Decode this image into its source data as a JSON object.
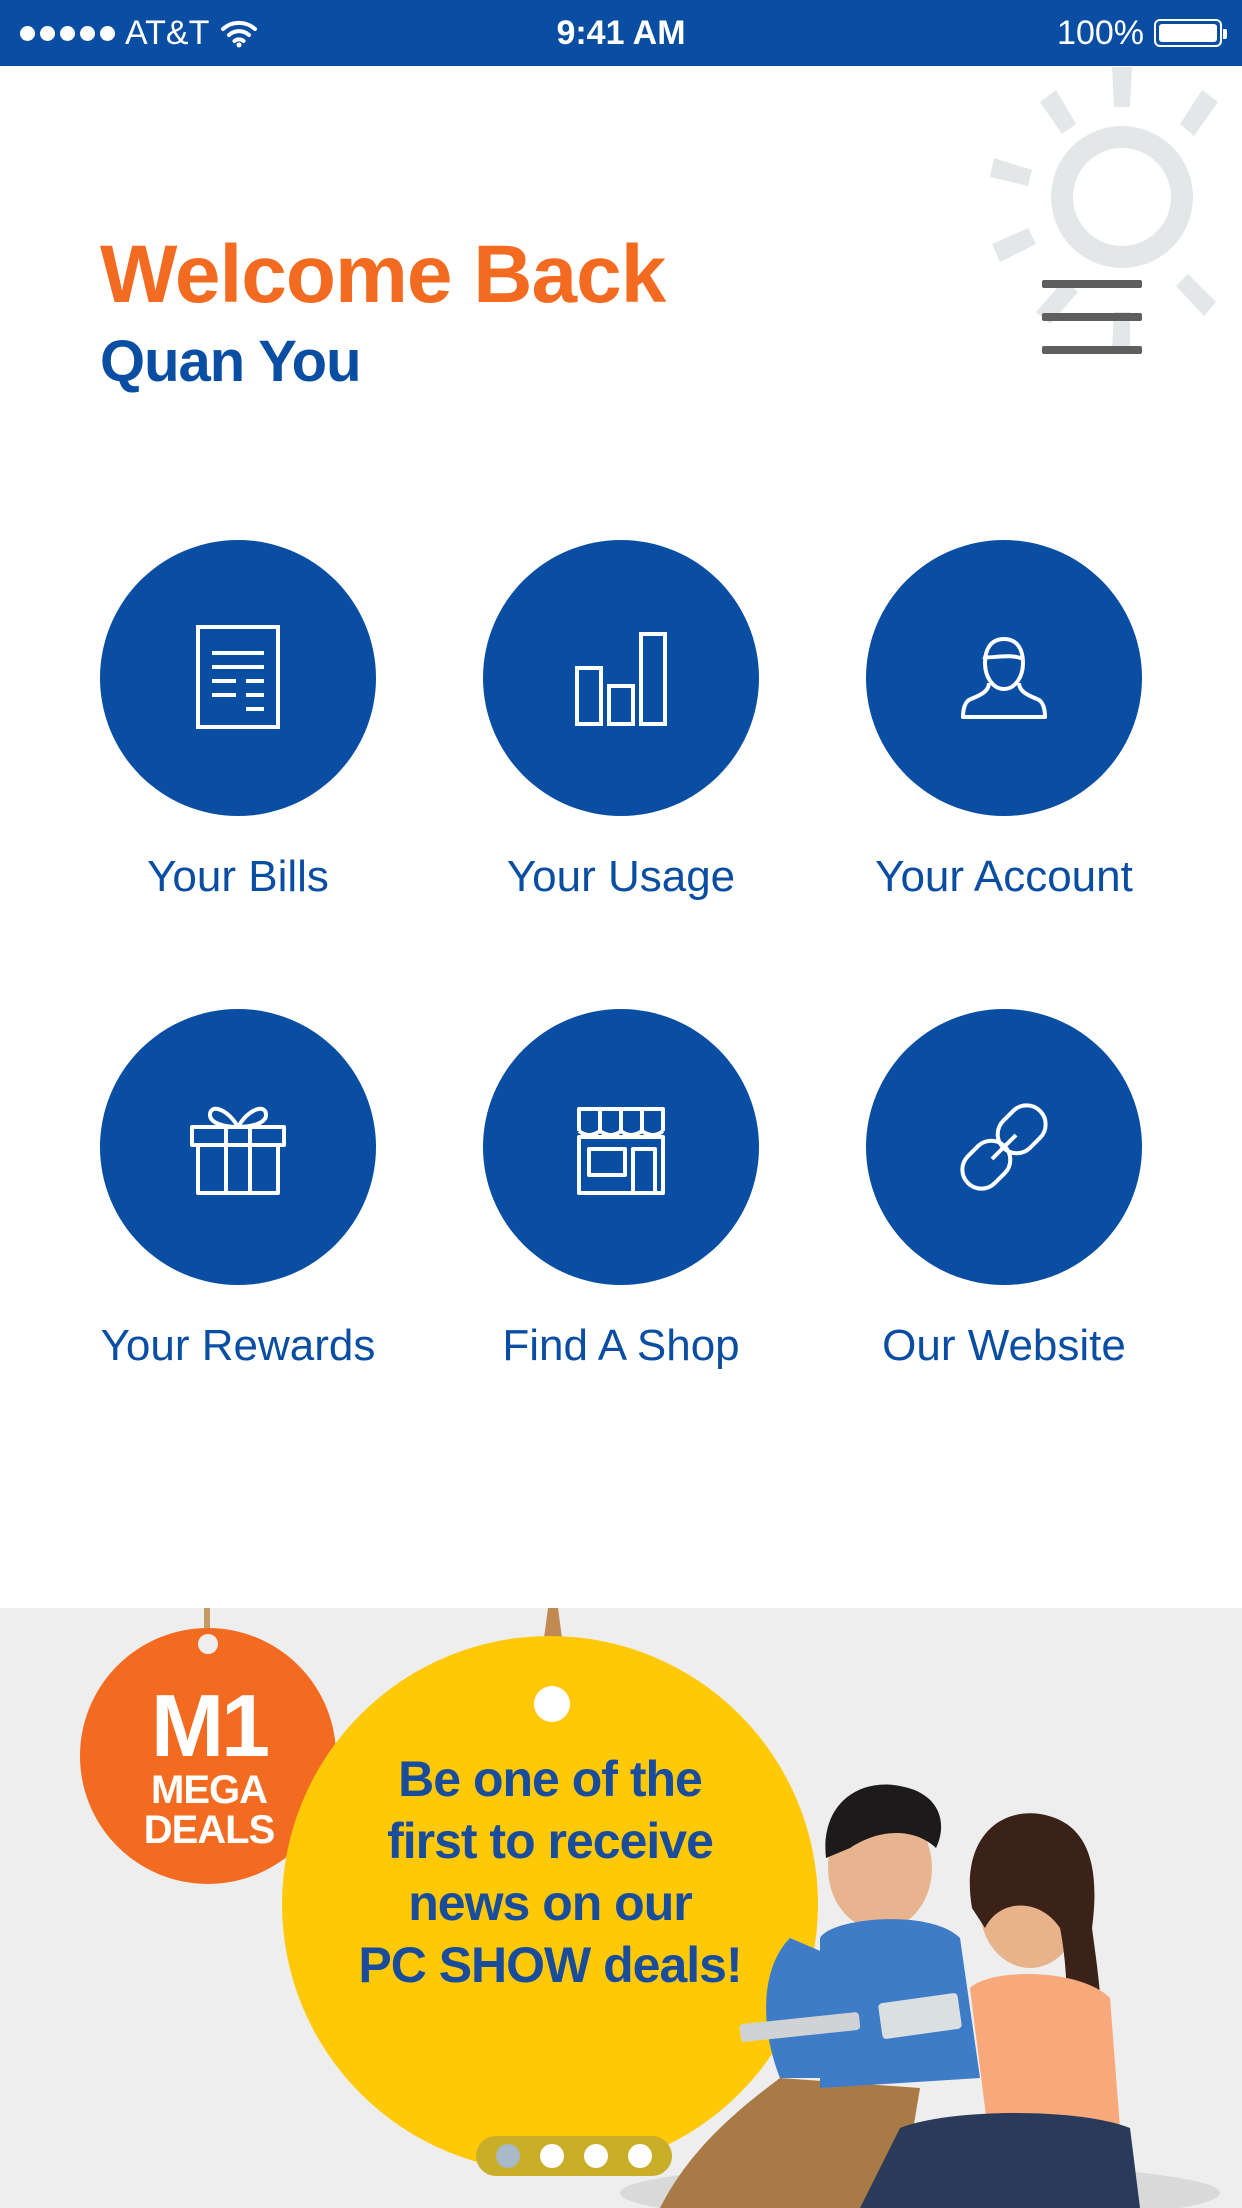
{
  "status_bar": {
    "carrier": "AT&T",
    "time": "9:41 AM",
    "battery": "100%"
  },
  "header": {
    "welcome": "Welcome Back",
    "user_name": "Quan You"
  },
  "tiles": [
    {
      "label": "Your Bills",
      "icon": "bill-document-icon"
    },
    {
      "label": "Your Usage",
      "icon": "bar-chart-icon"
    },
    {
      "label": "Your Account",
      "icon": "user-icon"
    },
    {
      "label": "Your Rewards",
      "icon": "gift-icon"
    },
    {
      "label": "Find A Shop",
      "icon": "shop-icon"
    },
    {
      "label": "Our Website",
      "icon": "link-icon"
    }
  ],
  "promo": {
    "badge_title": "M1",
    "badge_line1": "MEGA",
    "badge_line2": "DEALS",
    "line1": "Be one of the",
    "line2": "first to receive",
    "line3": "news on our",
    "line4": "PC SHOW deals!",
    "carousel_index": 1,
    "carousel_count": 4
  },
  "colors": {
    "brand_blue": "#0a4ea3",
    "brand_orange": "#f26b21",
    "promo_yellow": "#ffc907",
    "menu_gray": "#5e5e5e"
  }
}
